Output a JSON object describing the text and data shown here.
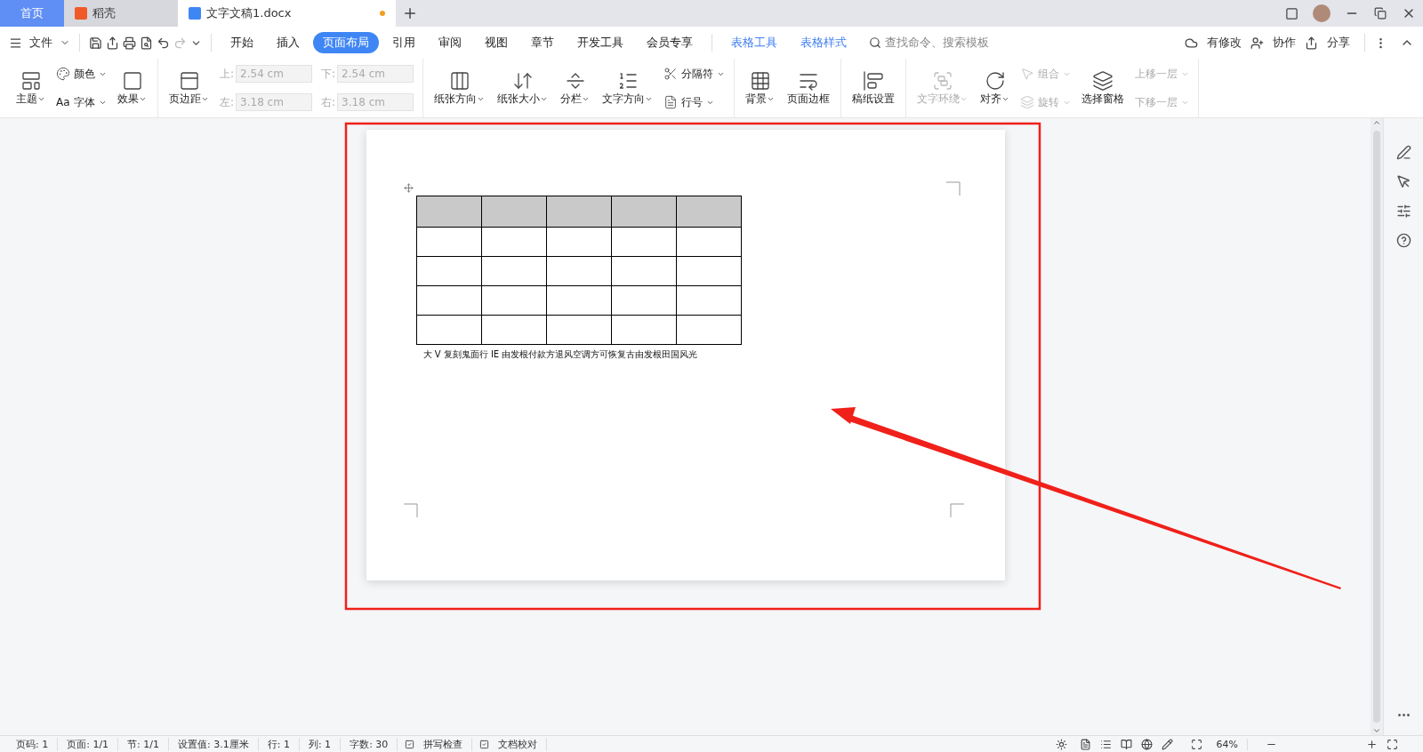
{
  "tabs": [
    {
      "label": "首页",
      "kind": "home",
      "selected": false
    },
    {
      "label": "稻壳",
      "kind": "docer",
      "selected": false
    },
    {
      "label": "文字文稿1.docx",
      "kind": "doc",
      "selected": true,
      "modified": true
    }
  ],
  "menu": {
    "file": "文件",
    "items": [
      {
        "label": "开始",
        "kind": "normal",
        "selected": false
      },
      {
        "label": "插入",
        "kind": "normal",
        "selected": false
      },
      {
        "label": "页面布局",
        "kind": "normal",
        "selected": true
      },
      {
        "label": "引用",
        "kind": "normal",
        "selected": false
      },
      {
        "label": "审阅",
        "kind": "normal",
        "selected": false
      },
      {
        "label": "视图",
        "kind": "normal",
        "selected": false
      },
      {
        "label": "章节",
        "kind": "normal",
        "selected": false
      },
      {
        "label": "开发工具",
        "kind": "normal",
        "selected": false
      },
      {
        "label": "会员专享",
        "kind": "normal",
        "selected": false
      },
      {
        "label": "表格工具",
        "kind": "context",
        "selected": false
      },
      {
        "label": "表格样式",
        "kind": "context",
        "selected": false
      }
    ],
    "search": {
      "placeholder": "查找命令、搜索模板"
    },
    "actions": [
      "有修改",
      "协作",
      "分享"
    ]
  },
  "ribbon": [
    {
      "columns": [
        {
          "kind": "big",
          "items": [
            {
              "label": "主题",
              "dropdown": true,
              "disabled": false
            }
          ]
        },
        {
          "kind": "stack",
          "items": [
            {
              "label": "颜色",
              "dropdown": true,
              "disabled": false
            },
            {
              "label": "字体",
              "glyph": "Aa",
              "dropdown": true,
              "disabled": false
            }
          ]
        },
        {
          "kind": "big",
          "items": [
            {
              "label": "效果",
              "dropdown": true,
              "disabled": false
            }
          ]
        }
      ]
    },
    {
      "columns": [
        {
          "kind": "big",
          "items": [
            {
              "label": "页边距",
              "dropdown": true,
              "disabled": false
            }
          ]
        },
        {
          "kind": "fields",
          "items": [
            {
              "label": "上:",
              "value": "2.54 cm",
              "disabled": true
            },
            {
              "label": "左:",
              "value": "3.18 cm",
              "disabled": true
            }
          ]
        },
        {
          "kind": "fields",
          "items": [
            {
              "label": "下:",
              "value": "2.54 cm",
              "disabled": true
            },
            {
              "label": "右:",
              "value": "3.18 cm",
              "disabled": true
            }
          ]
        }
      ]
    },
    {
      "columns": [
        {
          "kind": "big",
          "items": [
            {
              "label": "纸张方向",
              "dropdown": true,
              "disabled": false
            }
          ]
        },
        {
          "kind": "big",
          "items": [
            {
              "label": "纸张大小",
              "dropdown": true,
              "disabled": false
            }
          ]
        },
        {
          "kind": "big",
          "items": [
            {
              "label": "分栏",
              "dropdown": true,
              "disabled": false
            }
          ]
        },
        {
          "kind": "big",
          "items": [
            {
              "label": "文字方向",
              "dropdown": true,
              "disabled": false
            }
          ]
        },
        {
          "kind": "stack",
          "items": [
            {
              "label": "分隔符",
              "dropdown": true,
              "disabled": false
            },
            {
              "label": "行号",
              "dropdown": true,
              "disabled": false
            }
          ]
        }
      ]
    },
    {
      "columns": [
        {
          "kind": "big",
          "items": [
            {
              "label": "背景",
              "dropdown": true,
              "disabled": false
            }
          ]
        },
        {
          "kind": "big",
          "items": [
            {
              "label": "页面边框",
              "dropdown": false,
              "disabled": false
            }
          ]
        }
      ]
    },
    {
      "columns": [
        {
          "kind": "big",
          "items": [
            {
              "label": "稿纸设置",
              "dropdown": false,
              "disabled": false
            }
          ]
        }
      ]
    },
    {
      "columns": [
        {
          "kind": "big",
          "items": [
            {
              "label": "文字环绕",
              "dropdown": true,
              "disabled": true
            }
          ]
        },
        {
          "kind": "big",
          "items": [
            {
              "label": "对齐",
              "dropdown": true,
              "disabled": false
            }
          ]
        },
        {
          "kind": "stack",
          "items": [
            {
              "label": "组合",
              "dropdown": true,
              "disabled": true
            },
            {
              "label": "旋转",
              "dropdown": true,
              "disabled": true
            }
          ]
        },
        {
          "kind": "big",
          "items": [
            {
              "label": "选择窗格",
              "dropdown": false,
              "disabled": false
            }
          ]
        },
        {
          "kind": "stack",
          "items": [
            {
              "label": "上移一层",
              "dropdown": true,
              "disabled": true
            },
            {
              "label": "下移一层",
              "dropdown": true,
              "disabled": true
            }
          ]
        }
      ]
    }
  ],
  "document": {
    "table": {
      "rows": [
        {
          "shaded": true,
          "cells": [
            {
              "kind": "empty"
            },
            {
              "kind": "empty"
            },
            {
              "kind": "empty"
            },
            {
              "kind": "empty"
            },
            {
              "kind": "empty"
            }
          ]
        },
        {
          "shaded": false,
          "cells": [
            {
              "kind": "empty"
            },
            {
              "kind": "empty"
            },
            {
              "kind": "empty"
            },
            {
              "kind": "empty"
            },
            {
              "kind": "empty"
            }
          ]
        },
        {
          "shaded": false,
          "cells": [
            {
              "kind": "empty"
            },
            {
              "kind": "empty"
            },
            {
              "kind": "empty"
            },
            {
              "kind": "empty"
            },
            {
              "kind": "empty"
            }
          ]
        },
        {
          "shaded": false,
          "cells": [
            {
              "kind": "empty"
            },
            {
              "kind": "empty"
            },
            {
              "kind": "empty"
            },
            {
              "kind": "empty"
            },
            {
              "kind": "empty"
            }
          ]
        },
        {
          "shaded": false,
          "cells": [
            {
              "kind": "empty"
            },
            {
              "kind": "empty"
            },
            {
              "kind": "empty"
            },
            {
              "kind": "empty"
            },
            {
              "kind": "empty"
            }
          ]
        }
      ]
    },
    "paragraph": "大 V 复刻鬼面行 IE 由发根付款方退风空调方可恢复古由发根田国风光"
  },
  "status_bar": {
    "items": [
      "页码: 1",
      "页面: 1/1",
      "节: 1/1",
      "设置值: 3.1厘米",
      "行: 1",
      "列: 1",
      "字数: 30"
    ],
    "checks": [
      "拼写检查",
      "文档校对"
    ],
    "zoom": "64%"
  }
}
